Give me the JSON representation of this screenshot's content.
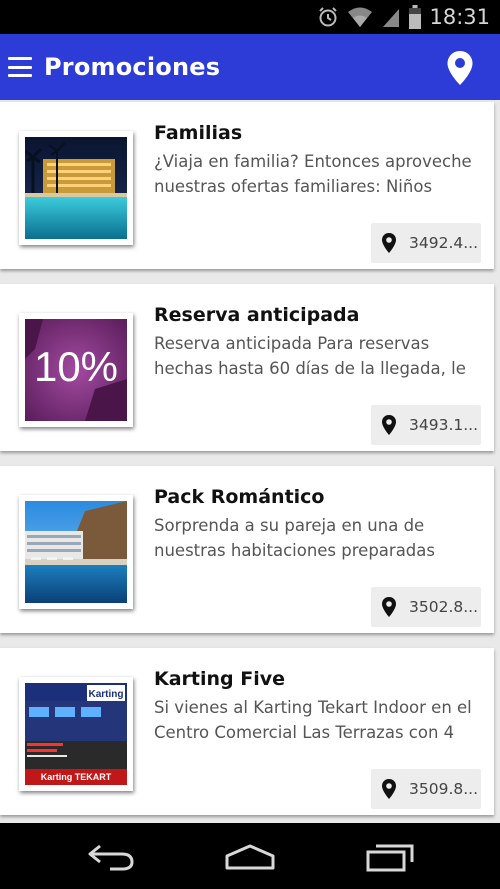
{
  "status_bar": {
    "time": "18:31"
  },
  "app_bar": {
    "title": "Promociones"
  },
  "promotions": [
    {
      "title": "Familias",
      "description": "¿Viaja en familia? Entonces aproveche nuestras ofertas familiares: Niños",
      "distance": "3492.4..."
    },
    {
      "title": "Reserva anticipada",
      "description": "Reserva anticipada Para reservas hechas hasta 60 días de la llegada, le",
      "distance": "3493.1...",
      "image_text": "10%"
    },
    {
      "title": "Pack Romántico",
      "description": "Sorprenda a su pareja en una de nuestras habitaciones preparadas",
      "distance": "3502.8..."
    },
    {
      "title": "Karting Five",
      "description": "Si vienes al Karting Tekart Indoor en el Centro Comercial Las Terrazas con 4",
      "distance": "3509.8...",
      "image_text": "Karting TEKART"
    }
  ],
  "icons": {
    "menu": "hamburger-icon",
    "map": "location-pin-icon",
    "distance": "location-pin-icon",
    "nav_back": "back-icon",
    "nav_home": "home-icon",
    "nav_recent": "recent-apps-icon"
  },
  "colors": {
    "app_bar": "#2d3cd6",
    "background": "#e9e9e9"
  }
}
